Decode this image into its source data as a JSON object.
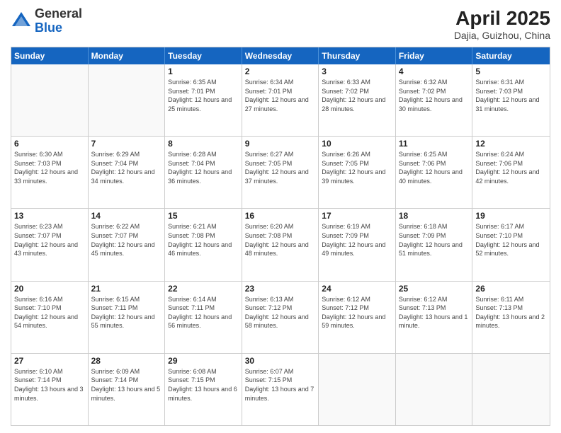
{
  "logo": {
    "general": "General",
    "blue": "Blue"
  },
  "title": "April 2025",
  "subtitle": "Dajia, Guizhou, China",
  "header_days": [
    "Sunday",
    "Monday",
    "Tuesday",
    "Wednesday",
    "Thursday",
    "Friday",
    "Saturday"
  ],
  "rows": [
    [
      {
        "day": "",
        "info": ""
      },
      {
        "day": "",
        "info": ""
      },
      {
        "day": "1",
        "info": "Sunrise: 6:35 AM\nSunset: 7:01 PM\nDaylight: 12 hours and 25 minutes."
      },
      {
        "day": "2",
        "info": "Sunrise: 6:34 AM\nSunset: 7:01 PM\nDaylight: 12 hours and 27 minutes."
      },
      {
        "day": "3",
        "info": "Sunrise: 6:33 AM\nSunset: 7:02 PM\nDaylight: 12 hours and 28 minutes."
      },
      {
        "day": "4",
        "info": "Sunrise: 6:32 AM\nSunset: 7:02 PM\nDaylight: 12 hours and 30 minutes."
      },
      {
        "day": "5",
        "info": "Sunrise: 6:31 AM\nSunset: 7:03 PM\nDaylight: 12 hours and 31 minutes."
      }
    ],
    [
      {
        "day": "6",
        "info": "Sunrise: 6:30 AM\nSunset: 7:03 PM\nDaylight: 12 hours and 33 minutes."
      },
      {
        "day": "7",
        "info": "Sunrise: 6:29 AM\nSunset: 7:04 PM\nDaylight: 12 hours and 34 minutes."
      },
      {
        "day": "8",
        "info": "Sunrise: 6:28 AM\nSunset: 7:04 PM\nDaylight: 12 hours and 36 minutes."
      },
      {
        "day": "9",
        "info": "Sunrise: 6:27 AM\nSunset: 7:05 PM\nDaylight: 12 hours and 37 minutes."
      },
      {
        "day": "10",
        "info": "Sunrise: 6:26 AM\nSunset: 7:05 PM\nDaylight: 12 hours and 39 minutes."
      },
      {
        "day": "11",
        "info": "Sunrise: 6:25 AM\nSunset: 7:06 PM\nDaylight: 12 hours and 40 minutes."
      },
      {
        "day": "12",
        "info": "Sunrise: 6:24 AM\nSunset: 7:06 PM\nDaylight: 12 hours and 42 minutes."
      }
    ],
    [
      {
        "day": "13",
        "info": "Sunrise: 6:23 AM\nSunset: 7:07 PM\nDaylight: 12 hours and 43 minutes."
      },
      {
        "day": "14",
        "info": "Sunrise: 6:22 AM\nSunset: 7:07 PM\nDaylight: 12 hours and 45 minutes."
      },
      {
        "day": "15",
        "info": "Sunrise: 6:21 AM\nSunset: 7:08 PM\nDaylight: 12 hours and 46 minutes."
      },
      {
        "day": "16",
        "info": "Sunrise: 6:20 AM\nSunset: 7:08 PM\nDaylight: 12 hours and 48 minutes."
      },
      {
        "day": "17",
        "info": "Sunrise: 6:19 AM\nSunset: 7:09 PM\nDaylight: 12 hours and 49 minutes."
      },
      {
        "day": "18",
        "info": "Sunrise: 6:18 AM\nSunset: 7:09 PM\nDaylight: 12 hours and 51 minutes."
      },
      {
        "day": "19",
        "info": "Sunrise: 6:17 AM\nSunset: 7:10 PM\nDaylight: 12 hours and 52 minutes."
      }
    ],
    [
      {
        "day": "20",
        "info": "Sunrise: 6:16 AM\nSunset: 7:10 PM\nDaylight: 12 hours and 54 minutes."
      },
      {
        "day": "21",
        "info": "Sunrise: 6:15 AM\nSunset: 7:11 PM\nDaylight: 12 hours and 55 minutes."
      },
      {
        "day": "22",
        "info": "Sunrise: 6:14 AM\nSunset: 7:11 PM\nDaylight: 12 hours and 56 minutes."
      },
      {
        "day": "23",
        "info": "Sunrise: 6:13 AM\nSunset: 7:12 PM\nDaylight: 12 hours and 58 minutes."
      },
      {
        "day": "24",
        "info": "Sunrise: 6:12 AM\nSunset: 7:12 PM\nDaylight: 12 hours and 59 minutes."
      },
      {
        "day": "25",
        "info": "Sunrise: 6:12 AM\nSunset: 7:13 PM\nDaylight: 13 hours and 1 minute."
      },
      {
        "day": "26",
        "info": "Sunrise: 6:11 AM\nSunset: 7:13 PM\nDaylight: 13 hours and 2 minutes."
      }
    ],
    [
      {
        "day": "27",
        "info": "Sunrise: 6:10 AM\nSunset: 7:14 PM\nDaylight: 13 hours and 3 minutes."
      },
      {
        "day": "28",
        "info": "Sunrise: 6:09 AM\nSunset: 7:14 PM\nDaylight: 13 hours and 5 minutes."
      },
      {
        "day": "29",
        "info": "Sunrise: 6:08 AM\nSunset: 7:15 PM\nDaylight: 13 hours and 6 minutes."
      },
      {
        "day": "30",
        "info": "Sunrise: 6:07 AM\nSunset: 7:15 PM\nDaylight: 13 hours and 7 minutes."
      },
      {
        "day": "",
        "info": ""
      },
      {
        "day": "",
        "info": ""
      },
      {
        "day": "",
        "info": ""
      }
    ]
  ]
}
